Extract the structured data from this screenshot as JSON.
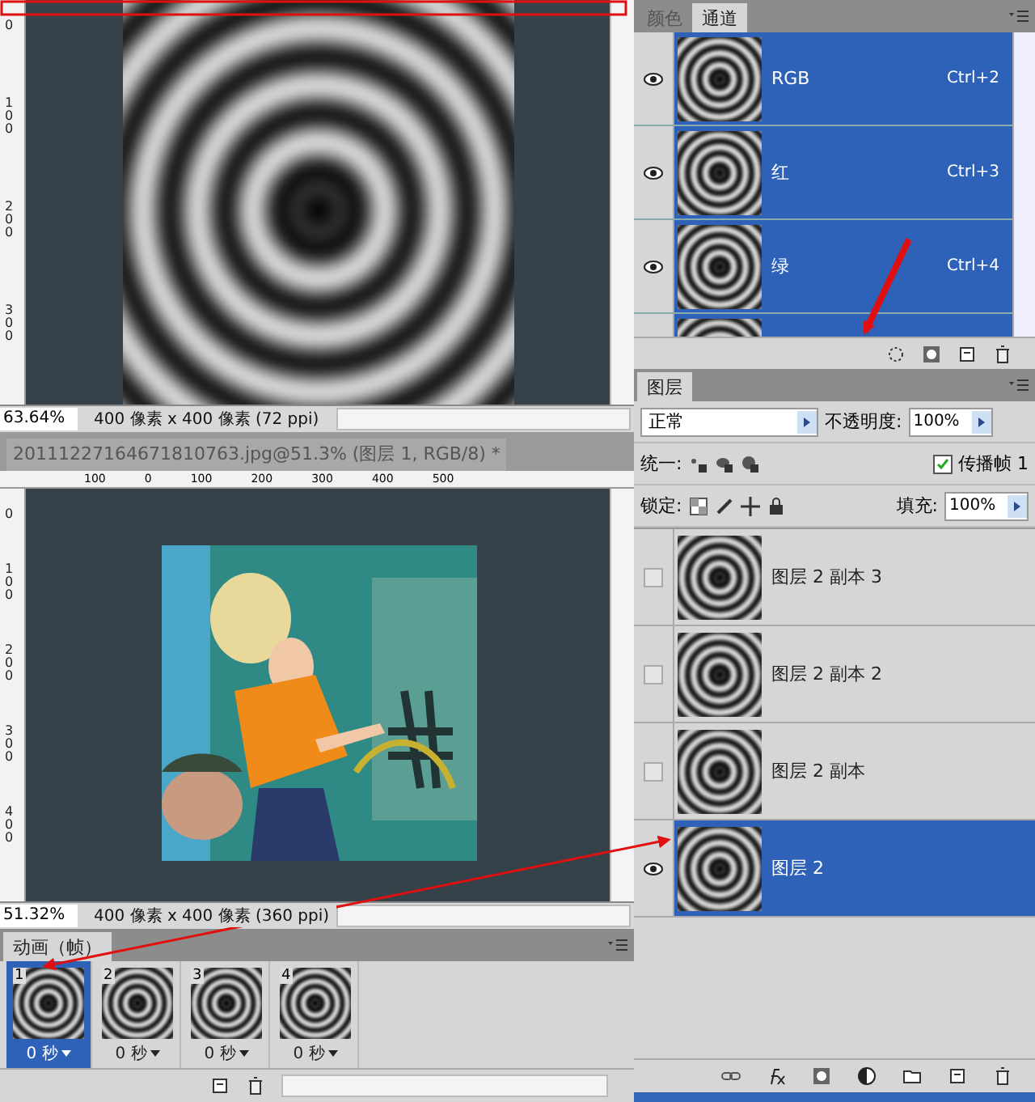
{
  "document_1": {
    "left_ruler": [
      "0",
      "100",
      "200",
      "300"
    ],
    "zoom": "63.64%",
    "info": "400 像素 x 400 像素 (72 ppi)"
  },
  "document_2": {
    "tab": "20111227164671810763.jpg@51.3% (图层 1, RGB/8) *",
    "top_ruler": [
      "100",
      "0",
      "100",
      "200",
      "300",
      "400",
      "500"
    ],
    "left_ruler": [
      "0",
      "100",
      "200",
      "300",
      "400"
    ],
    "zoom": "51.32%",
    "info": "400 像素 x 400 像素 (360 ppi)"
  },
  "animation": {
    "tab": "动画（帧）",
    "frames": [
      {
        "number": "1",
        "delay": "0 秒",
        "selected": true
      },
      {
        "number": "2",
        "delay": "0 秒",
        "selected": false
      },
      {
        "number": "3",
        "delay": "0 秒",
        "selected": false
      },
      {
        "number": "4",
        "delay": "0 秒",
        "selected": false
      }
    ]
  },
  "channels_panel": {
    "tabs": [
      {
        "label": "颜色",
        "selected": false
      },
      {
        "label": "通道",
        "selected": true
      }
    ],
    "channels": [
      {
        "name": "RGB",
        "shortcut": "Ctrl+2",
        "visible": true,
        "selected": true
      },
      {
        "name": "红",
        "shortcut": "Ctrl+3",
        "visible": true,
        "selected": true
      },
      {
        "name": "绿",
        "shortcut": "Ctrl+4",
        "visible": true,
        "selected": true
      }
    ]
  },
  "layers_panel": {
    "tab": "图层",
    "blend_mode": "正常",
    "opacity_label": "不透明度:",
    "opacity": "100%",
    "unify_label": "统一:",
    "propagate": {
      "label": "传播帧 1",
      "checked": true
    },
    "lock_label": "锁定:",
    "fill_label": "填充:",
    "fill": "100%",
    "layers": [
      {
        "name": "图层 2 副本 3",
        "visible": false,
        "selected": false
      },
      {
        "name": "图层 2 副本 2",
        "visible": false,
        "selected": false
      },
      {
        "name": "图层 2 副本",
        "visible": false,
        "selected": false
      },
      {
        "name": "图层 2",
        "visible": true,
        "selected": true
      }
    ]
  }
}
